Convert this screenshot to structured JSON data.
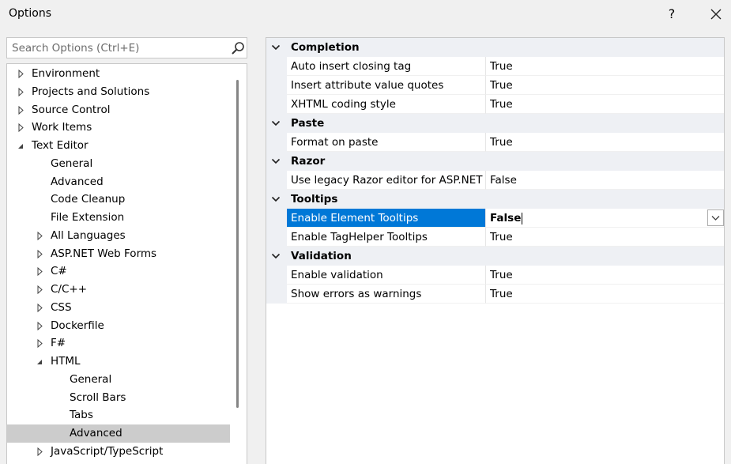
{
  "window": {
    "title": "Options",
    "help_label": "?"
  },
  "search": {
    "placeholder": "Search Options (Ctrl+E)"
  },
  "tree": {
    "items": [
      {
        "label": "Environment",
        "expander": "collapsed",
        "level": 0
      },
      {
        "label": "Projects and Solutions",
        "expander": "collapsed",
        "level": 0
      },
      {
        "label": "Source Control",
        "expander": "collapsed",
        "level": 0
      },
      {
        "label": "Work Items",
        "expander": "collapsed",
        "level": 0
      },
      {
        "label": "Text Editor",
        "expander": "expanded",
        "level": 0
      },
      {
        "label": "General",
        "expander": "none",
        "level": 1
      },
      {
        "label": "Advanced",
        "expander": "none",
        "level": 1
      },
      {
        "label": "Code Cleanup",
        "expander": "none",
        "level": 1
      },
      {
        "label": "File Extension",
        "expander": "none",
        "level": 1
      },
      {
        "label": "All Languages",
        "expander": "collapsed",
        "level": 1
      },
      {
        "label": "ASP.NET Web Forms",
        "expander": "collapsed",
        "level": 1
      },
      {
        "label": "C#",
        "expander": "collapsed",
        "level": 1
      },
      {
        "label": "C/C++",
        "expander": "collapsed",
        "level": 1
      },
      {
        "label": "CSS",
        "expander": "collapsed",
        "level": 1
      },
      {
        "label": "Dockerfile",
        "expander": "collapsed",
        "level": 1
      },
      {
        "label": "F#",
        "expander": "collapsed",
        "level": 1
      },
      {
        "label": "HTML",
        "expander": "expanded",
        "level": 1
      },
      {
        "label": "General",
        "expander": "none",
        "level": 2
      },
      {
        "label": "Scroll Bars",
        "expander": "none",
        "level": 2
      },
      {
        "label": "Tabs",
        "expander": "none",
        "level": 2
      },
      {
        "label": "Advanced",
        "expander": "none",
        "level": 2,
        "selected": true
      },
      {
        "label": "JavaScript/TypeScript",
        "expander": "collapsed",
        "level": 1
      }
    ]
  },
  "grid": {
    "categories": [
      {
        "name": "Completion",
        "properties": [
          {
            "name": "Auto insert closing tag",
            "value": "True"
          },
          {
            "name": "Insert attribute value quotes",
            "value": "True"
          },
          {
            "name": "XHTML coding style",
            "value": "True"
          }
        ]
      },
      {
        "name": "Paste",
        "properties": [
          {
            "name": "Format on paste",
            "value": "True"
          }
        ]
      },
      {
        "name": "Razor",
        "properties": [
          {
            "name": "Use legacy Razor editor for ASP.NET Core",
            "value": "False"
          }
        ]
      },
      {
        "name": "Tooltips",
        "properties": [
          {
            "name": "Enable Element Tooltips",
            "value": "False",
            "selected": true
          },
          {
            "name": "Enable TagHelper Tooltips",
            "value": "True"
          }
        ]
      },
      {
        "name": "Validation",
        "properties": [
          {
            "name": "Enable validation",
            "value": "True"
          },
          {
            "name": "Show errors as warnings",
            "value": "True"
          }
        ]
      }
    ]
  },
  "colors": {
    "selection_blue": "#0078d7",
    "category_bg": "#eef0f4",
    "tree_selected_bg": "#cccccc"
  }
}
